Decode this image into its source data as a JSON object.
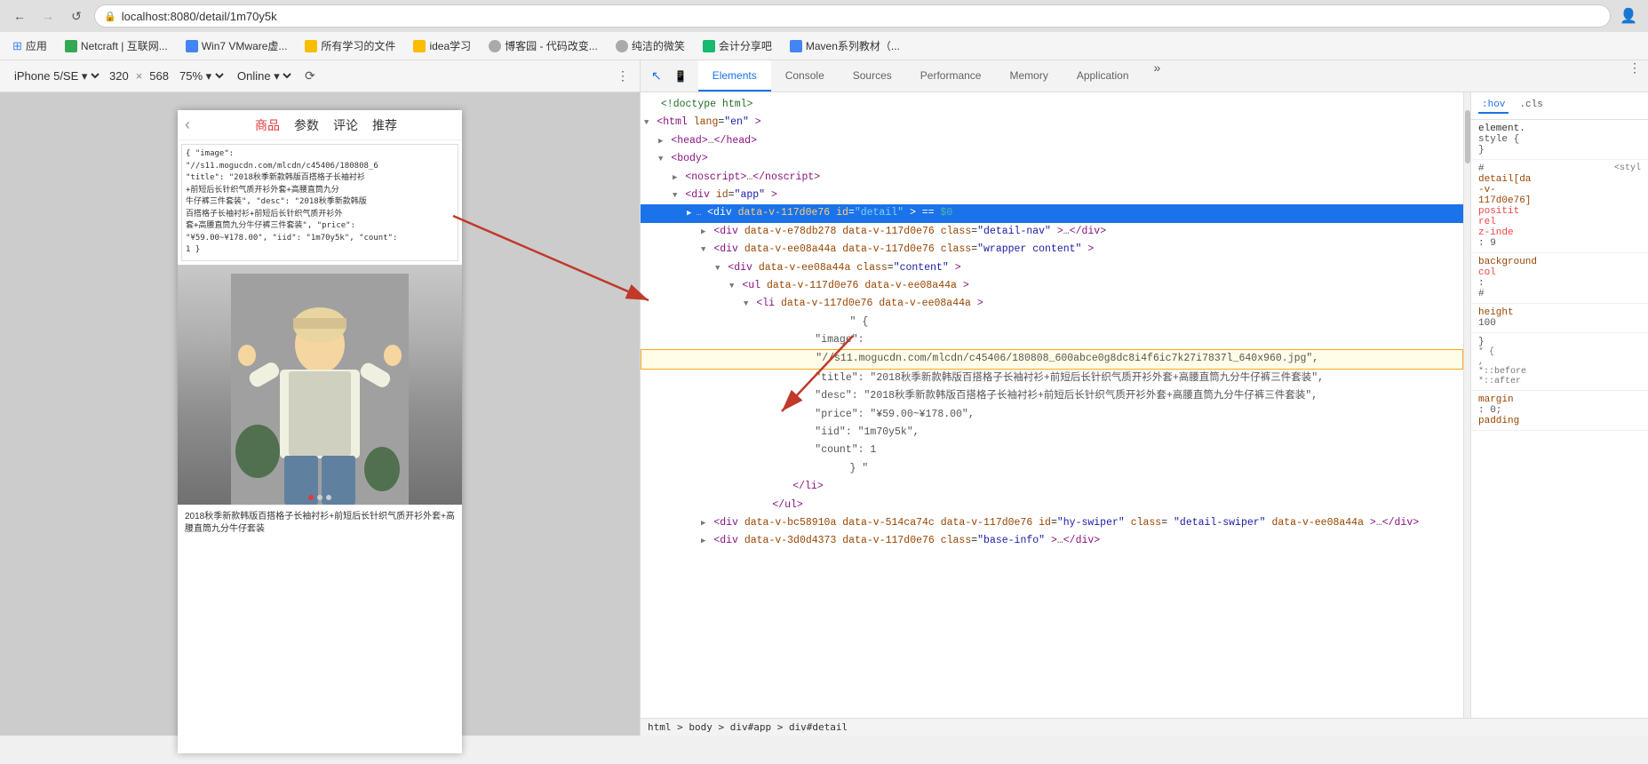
{
  "browser": {
    "url": "localhost:8080/detail/1m70y5k",
    "back_disabled": false,
    "forward_disabled": false
  },
  "bookmarks": [
    {
      "id": "apps",
      "label": "应用",
      "color": "#4285f4"
    },
    {
      "id": "netcraft",
      "label": "Netcraft | 互联网...",
      "color": "#34a853"
    },
    {
      "id": "win7vm",
      "label": "Win7 VMware虚...",
      "color": "#4285f4"
    },
    {
      "id": "study-files",
      "label": "所有学习的文件",
      "color": "#fbbc04"
    },
    {
      "id": "idea",
      "label": "idea学习",
      "color": "#fbbc04"
    },
    {
      "id": "blog",
      "label": "博客园 - 代码改变...",
      "color": "#aaa"
    },
    {
      "id": "smile",
      "label": "纯洁的微笑",
      "color": "#aaa"
    },
    {
      "id": "account",
      "label": "会计分享吧",
      "color": "#19b96f"
    },
    {
      "id": "maven",
      "label": "Maven系列教材（...",
      "color": "#4285f4"
    }
  ],
  "device_toolbar": {
    "device_name": "iPhone 5/SE",
    "width": "320",
    "height": "568",
    "zoom": "75%",
    "network": "Online"
  },
  "mobile_nav": {
    "back": "‹",
    "items": [
      "商品",
      "参数",
      "评论",
      "推荐"
    ],
    "active": "商品"
  },
  "json_data_preview": "{ \"image\":\n\"//s11.mogucdn.com/mlcdn/c45406/180808_6\n \"title\": \"2018秋季新款韩版百搭格子长袖衬衫\n+前短后长针织气质开衫外套+高腰直筒九分\n牛仔裤三件套装\", \"desc\": \"2018秋季新款韩版\n百搭格子长袖衬衫+前短后长针织气质开衫外\n套+高腰直筒九分牛仔裤三件套装\", \"price\":\n\"¥59.00~¥178.00\", \"iid\": \"1m70y5k\", \"count\":\n1 }",
  "product_caption": "2018秋季新款韩版百搭格子长袖衬衫+前短后长针织气质开衫外套+高腰直筒九分牛仔套装",
  "devtools": {
    "tabs": [
      "Elements",
      "Console",
      "Sources",
      "Performance",
      "Memory",
      "Application"
    ],
    "active_tab": "Elements",
    "left_icons": [
      "cursor",
      "device"
    ],
    "right_icons": [
      "more",
      "settings"
    ]
  },
  "elements": {
    "lines": [
      {
        "id": 1,
        "indent": 0,
        "content": "<!doctype html>",
        "type": "comment"
      },
      {
        "id": 2,
        "indent": 0,
        "content": "<html lang=\"en\">",
        "type": "open-tag"
      },
      {
        "id": 3,
        "indent": 1,
        "content": "<head>…</head>",
        "type": "collapsed"
      },
      {
        "id": 4,
        "indent": 1,
        "content": "<body>",
        "type": "open-tag",
        "expandable": true
      },
      {
        "id": 5,
        "indent": 2,
        "content": "<noscript>…</noscript>",
        "type": "collapsed"
      },
      {
        "id": 6,
        "indent": 2,
        "content": "<div id=\"app\">",
        "type": "open-tag",
        "expandable": true
      },
      {
        "id": 7,
        "indent": 3,
        "content": "<div data-v-117d0e76 id=\"detail\"> == $0",
        "type": "selected"
      },
      {
        "id": 8,
        "indent": 4,
        "content": "<div data-v-e78db278 data-v-117d0e76 class=\"detail-nav\">…</div>",
        "type": "collapsed"
      },
      {
        "id": 9,
        "indent": 4,
        "content": "<div data-v-ee08a44a data-v-117d0e76 class=\"wrapper content\">",
        "type": "open-tag"
      },
      {
        "id": 10,
        "indent": 5,
        "content": "<div data-v-ee08a44a class=\"content\">",
        "type": "open-tag"
      },
      {
        "id": 11,
        "indent": 6,
        "content": "<ul data-v-117d0e76 data-v-ee08a44a>",
        "type": "open-tag"
      },
      {
        "id": 12,
        "indent": 7,
        "content": "<li data-v-117d0e76 data-v-ee08a44a>",
        "type": "open-tag"
      },
      {
        "id": 13,
        "indent": 8,
        "content": "\" {",
        "type": "text"
      },
      {
        "id": 14,
        "indent": 9,
        "content": "\"image\":",
        "type": "text"
      },
      {
        "id": 15,
        "indent": 9,
        "content": "\"//s11.mogucdn.com/mlcdn/c45406/180808_600abce0g8dc8i4f6ic7k27i7837l_640x960.jpg\",",
        "type": "text-highlight"
      },
      {
        "id": 16,
        "indent": 9,
        "content": "\"title\": \"2018秋季新款韩版百搭格子长袖衬衫+前短后长针织气质开衫外套+高腰直筒九分牛仔裤三件套装\",",
        "type": "text"
      },
      {
        "id": 17,
        "indent": 9,
        "content": "\"desc\": \"2018秋季新款韩版百搭格子长袖衬衫+前短后长针织气质开衫外套+高腰直筒九分牛仔裤三件套装\",",
        "type": "text"
      },
      {
        "id": 18,
        "indent": 9,
        "content": "\"price\": \"¥59.00~¥178.00\",",
        "type": "text"
      },
      {
        "id": 19,
        "indent": 9,
        "content": "\"iid\": \"1m70y5k\",",
        "type": "text"
      },
      {
        "id": 20,
        "indent": 9,
        "content": "\"count\": 1",
        "type": "text"
      },
      {
        "id": 21,
        "indent": 8,
        "content": "} \"",
        "type": "text"
      },
      {
        "id": 22,
        "indent": 7,
        "content": "</li>",
        "type": "close-tag"
      },
      {
        "id": 23,
        "indent": 6,
        "content": "</ul>",
        "type": "close-tag"
      },
      {
        "id": 24,
        "indent": 4,
        "content": "<div data-v-bc58910a data-v-514ca74c data-v-117d0e76 id=\"hy-swiper\" class=\"detail-swiper\" data-v-ee08a44a>…</div>",
        "type": "collapsed"
      },
      {
        "id": 25,
        "indent": 4,
        "content": "<div data-v-3d0d4373 data-v-117d0e76 class=\"base-info\">…</div>",
        "type": "collapsed"
      }
    ]
  },
  "styles": {
    "header_tabs": [
      ":hov",
      ".cls"
    ],
    "rules": [
      {
        "selector": "element.",
        "source": "",
        "properties": [
          {
            "name": "style",
            "value": "{"
          },
          {
            "name": "}",
            "value": ""
          }
        ]
      },
      {
        "selector": "#",
        "source": "<styl",
        "properties": [
          {
            "name": "detail[da",
            "value": ""
          },
          {
            "name": "-v-",
            "value": ""
          },
          {
            "name": "117d0e76]",
            "value": ""
          },
          {
            "name": "positit",
            "value": "..."
          },
          {
            "name": "rel",
            "value": ""
          },
          {
            "name": "z-inde",
            "value": ""
          },
          {
            "name": ": 9",
            "value": ""
          }
        ]
      },
      {
        "selector": "background",
        "source": "",
        "properties": [
          {
            "name": "col",
            "value": ""
          },
          {
            "name": ":",
            "value": ""
          },
          {
            "name": "#",
            "value": ""
          }
        ]
      },
      {
        "selector": "height",
        "source": "",
        "properties": [
          {
            "name": "100",
            "value": ""
          }
        ]
      }
    ]
  },
  "bottom_breadcrumb": "html > body > div#app > div#detail",
  "icons": {
    "back_arrow": "←",
    "forward_arrow": "→",
    "reload": "↺",
    "lock": "🔒",
    "more_vert": "⋮",
    "cursor_tool": "↖",
    "device_tool": "📱",
    "expand_arrow_down": "▼",
    "expand_arrow_right": "▶"
  }
}
